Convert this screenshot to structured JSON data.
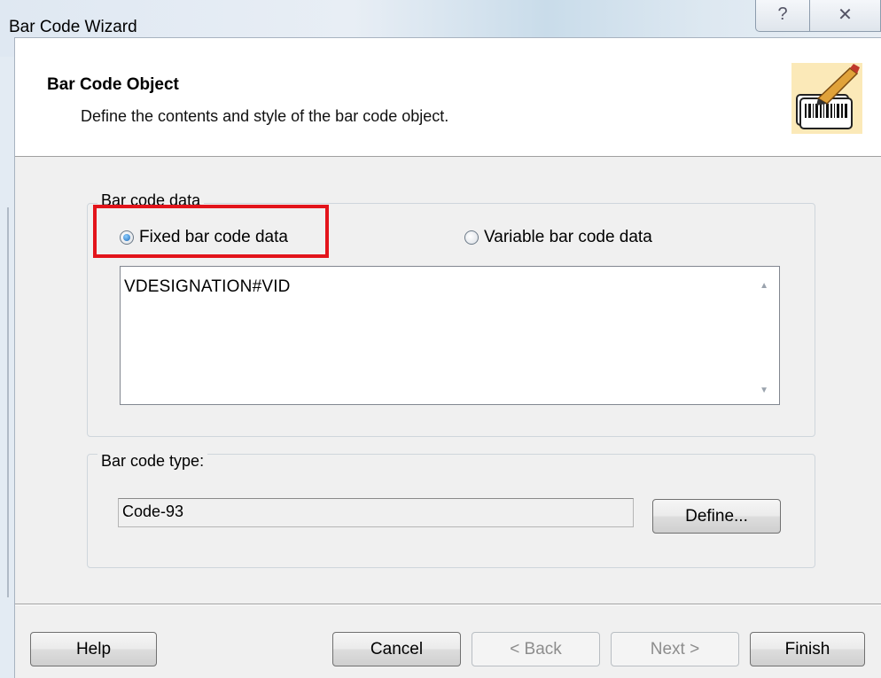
{
  "window": {
    "title": "Bar Code Wizard",
    "help_glyph": "?",
    "close_glyph": "✕"
  },
  "header": {
    "title": "Bar Code Object",
    "subtitle": "Define the contents and style of the bar code object.",
    "icon": "barcode-wizard-icon"
  },
  "data_group": {
    "label": "Bar code data",
    "radio_fixed": {
      "label": "Fixed bar code data",
      "checked": true
    },
    "radio_variable": {
      "label": "Variable bar code data",
      "checked": false
    },
    "value": "VDESIGNATION#VID"
  },
  "type_group": {
    "label": "Bar code type:",
    "value": "Code-93",
    "define_label": "Define..."
  },
  "buttons": {
    "help": "Help",
    "cancel": "Cancel",
    "back": "< Back",
    "next": "Next >",
    "finish": "Finish"
  },
  "colors": {
    "highlight": "#e3141b",
    "header_bg": "#ffffff",
    "dialog_bg": "#f0f0f0"
  }
}
